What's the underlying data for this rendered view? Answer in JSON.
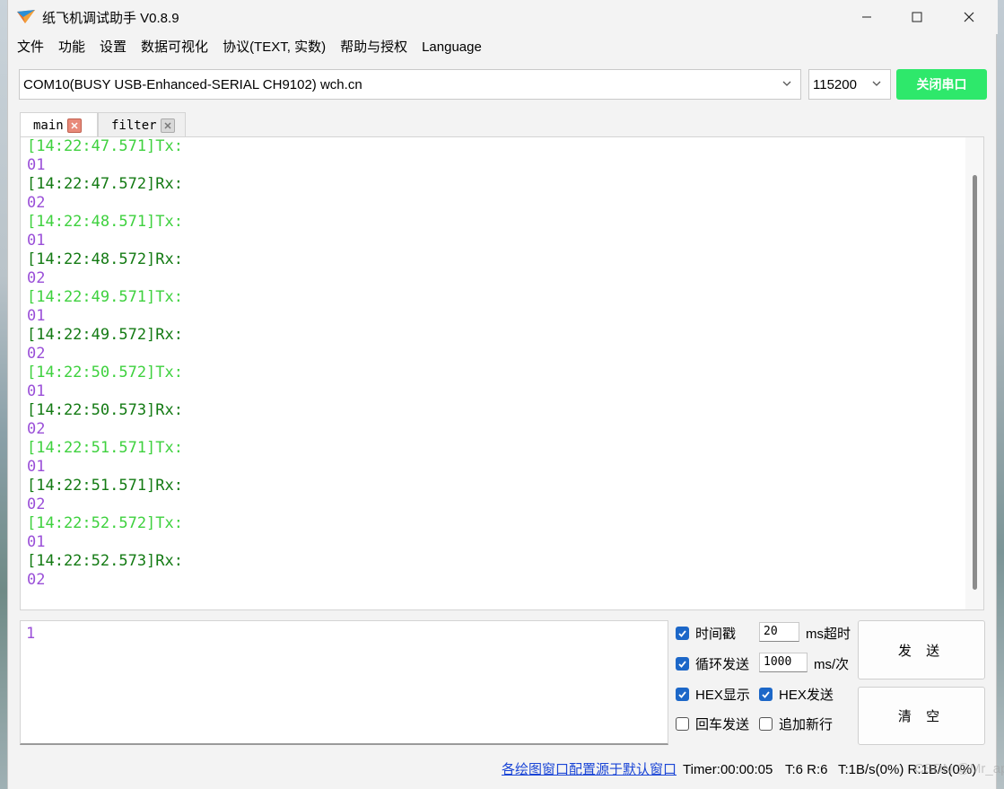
{
  "window": {
    "title": "纸飞机调试助手 V0.8.9"
  },
  "menu": {
    "items": [
      "文件",
      "功能",
      "设置",
      "数据可视化",
      "协议(TEXT, 实数)",
      "帮助与授权",
      "Language"
    ]
  },
  "toolbar": {
    "port_value": "COM10(BUSY  USB-Enhanced-SERIAL CH9102) wch.cn",
    "baud_value": "115200",
    "close_port_label": "关闭串口",
    "close_port_color": "#2ee86b"
  },
  "tabs": [
    {
      "label": "main",
      "active": true
    },
    {
      "label": "filter",
      "active": false
    }
  ],
  "receive": {
    "lines": [
      {
        "text": "[14:22:47.571]Tx:",
        "kind": "tx"
      },
      {
        "text": "01",
        "kind": "data"
      },
      {
        "text": "[14:22:47.572]Rx:",
        "kind": "rx"
      },
      {
        "text": "02",
        "kind": "data"
      },
      {
        "text": "[14:22:48.571]Tx:",
        "kind": "tx"
      },
      {
        "text": "01",
        "kind": "data"
      },
      {
        "text": "[14:22:48.572]Rx:",
        "kind": "rx"
      },
      {
        "text": "02",
        "kind": "data"
      },
      {
        "text": "[14:22:49.571]Tx:",
        "kind": "tx"
      },
      {
        "text": "01",
        "kind": "data"
      },
      {
        "text": "[14:22:49.572]Rx:",
        "kind": "rx"
      },
      {
        "text": "02",
        "kind": "data"
      },
      {
        "text": "[14:22:50.572]Tx:",
        "kind": "tx"
      },
      {
        "text": "01",
        "kind": "data"
      },
      {
        "text": "[14:22:50.573]Rx:",
        "kind": "rx"
      },
      {
        "text": "02",
        "kind": "data"
      },
      {
        "text": "[14:22:51.571]Tx:",
        "kind": "tx"
      },
      {
        "text": "01",
        "kind": "data"
      },
      {
        "text": "[14:22:51.571]Rx:",
        "kind": "rx"
      },
      {
        "text": "02",
        "kind": "data"
      },
      {
        "text": "[14:22:52.572]Tx:",
        "kind": "tx"
      },
      {
        "text": "01",
        "kind": "data"
      },
      {
        "text": "[14:22:52.573]Rx:",
        "kind": "rx"
      },
      {
        "text": "02",
        "kind": "data"
      }
    ],
    "colors": {
      "tx": "#3ed13e",
      "rx": "#137a13",
      "data": "#9a4fd8"
    }
  },
  "send": {
    "text": "1",
    "timestamp_label": "时间戳",
    "timestamp_checked": true,
    "timeout_value": "20",
    "timeout_unit": "ms超时",
    "loop_label": "循环发送",
    "loop_checked": true,
    "interval_value": "1000",
    "interval_unit": "ms/次",
    "hex_display_label": "HEX显示",
    "hex_display_checked": true,
    "hex_send_label": "HEX发送",
    "hex_send_checked": true,
    "cr_send_label": "回车发送",
    "cr_send_checked": false,
    "newline_label": "追加新行",
    "newline_checked": false,
    "send_button": "发 送",
    "clear_button": "清 空"
  },
  "status": {
    "link_text": "各绘图窗口配置源于默认窗口",
    "timer": "Timer:00:00:05",
    "counts": "T:6 R:6",
    "rates": "T:1B/s(0%) R:1B/s(0%)",
    "watermark": "CSDN @Mr_apple"
  }
}
